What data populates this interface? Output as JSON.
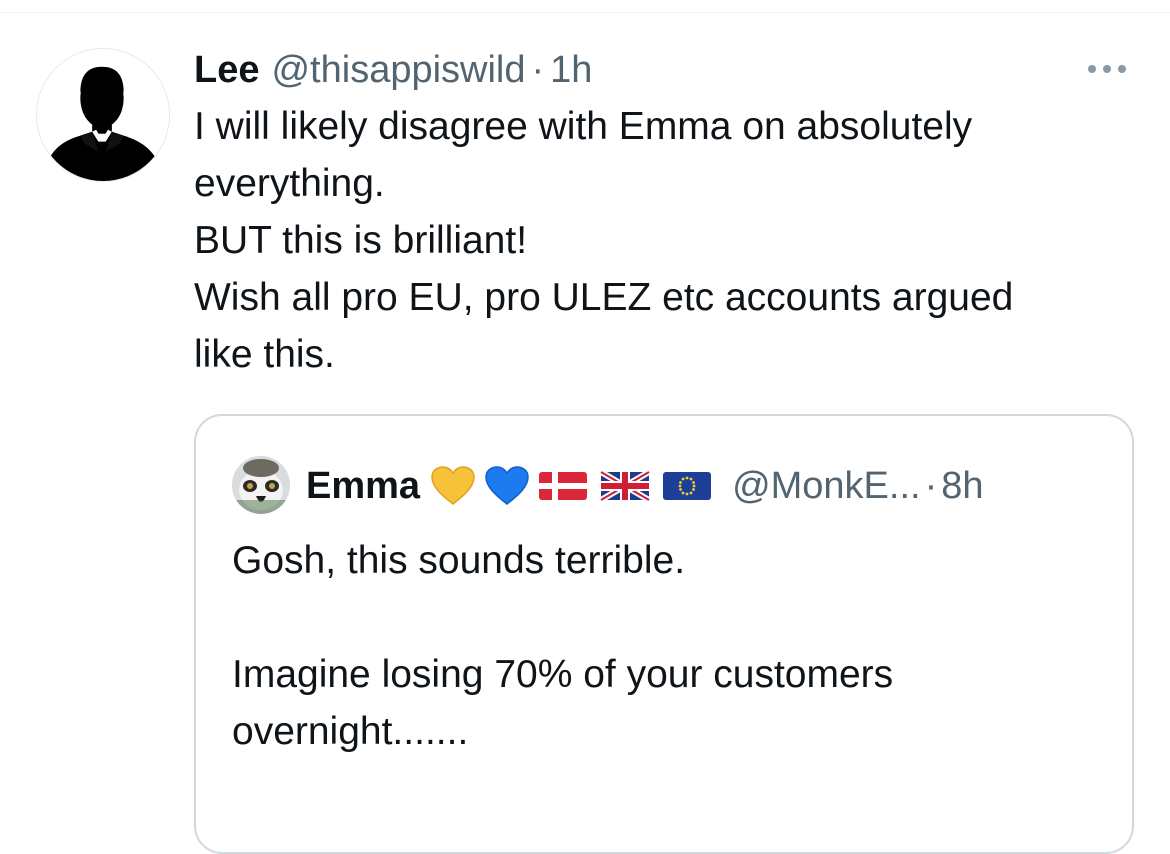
{
  "tweet": {
    "author_name": "Lee",
    "handle": "@thisappiswild",
    "separator": "·",
    "time": "1h",
    "lines": [
      "I will likely disagree with Emma on absolutely",
      "everything.",
      "BUT this is brilliant!",
      "Wish all pro EU, pro ULEZ etc accounts argued",
      "like this."
    ]
  },
  "quoted_tweet": {
    "author_name": "Emma",
    "handle": "@MonkE...",
    "separator": "·",
    "time": "8h",
    "lines": [
      "Gosh, this sounds terrible.",
      "",
      "Imagine losing 70% of your customers",
      "overnight......."
    ]
  },
  "icons": {
    "avatar": "silhouette-avatar",
    "more": "more-options-icon",
    "quoted_avatar": "lemur-avatar",
    "badges": [
      "yellow-heart-emoji",
      "blue-heart-emoji",
      "denmark-flag-emoji",
      "uk-flag-emoji",
      "eu-flag-emoji"
    ]
  },
  "colors": {
    "text": "#0f1419",
    "secondary_text": "#536471",
    "border": "#cfd9de",
    "background": "#ffffff"
  }
}
